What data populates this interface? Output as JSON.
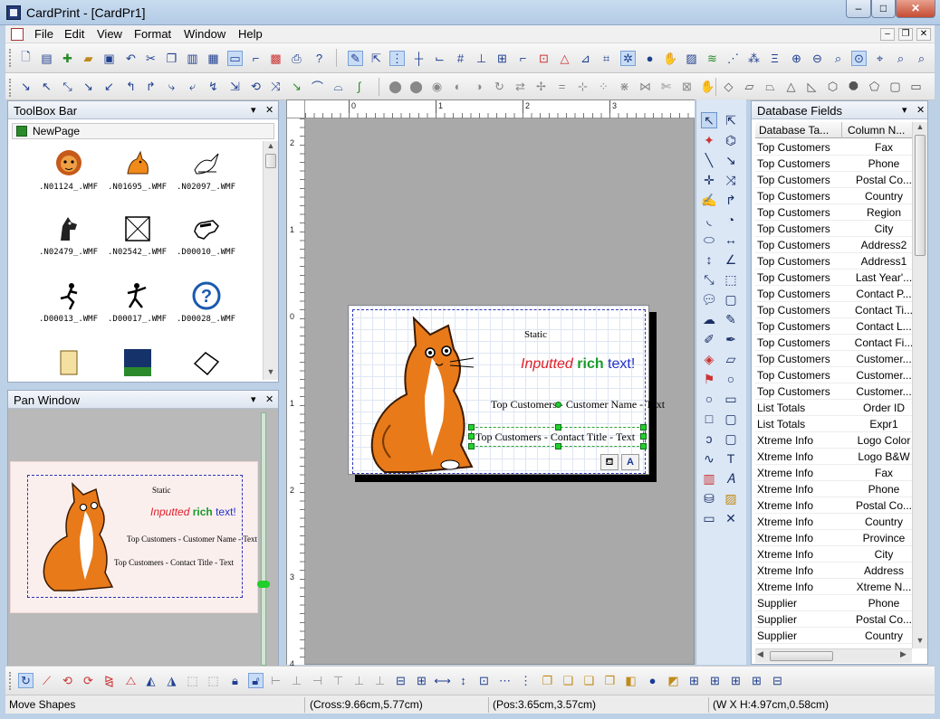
{
  "window": {
    "title": "CardPrint - [CardPr1]",
    "minimize": "–",
    "maximize": "□",
    "close": "✕"
  },
  "menu": {
    "items": [
      "File",
      "Edit",
      "View",
      "Format",
      "Window",
      "Help"
    ],
    "mdi": {
      "minimize": "–",
      "restore": "❐",
      "close": "✕"
    }
  },
  "toolbox": {
    "title": "ToolBox Bar",
    "newpage_label": "NewPage",
    "items": [
      {
        "label": ".N01124_.WMF",
        "icon": "lion-clipart"
      },
      {
        "label": ".N01695_.WMF",
        "icon": "fox-clipart"
      },
      {
        "label": ".N02097_.WMF",
        "icon": "bird-clipart"
      },
      {
        "label": ".N02479_.WMF",
        "icon": "horse-clipart"
      },
      {
        "label": ".N02542_.WMF",
        "icon": "envelope-clipart"
      },
      {
        "label": ".D00010_.WMF",
        "icon": "dog-clipart"
      },
      {
        "label": ".D00013_.WMF",
        "icon": "runner-clipart"
      },
      {
        "label": ".D00017_.WMF",
        "icon": "dancer-clipart"
      },
      {
        "label": ".D00028_.WMF",
        "icon": "help-clipart"
      }
    ]
  },
  "pan": {
    "title": "Pan Window",
    "static_text": "Static",
    "rich_1": "Inputted",
    "rich_2": "rich",
    "rich_3": "text!",
    "line_1": "Top Customers - Customer Name - Text",
    "line_2": "Top Customers - Contact Title - Text"
  },
  "card": {
    "static_text": "Static",
    "rich_1": "Inputted",
    "rich_2": "rich",
    "rich_3": "text!",
    "line_1": "Top Customers - Customer Name - Text",
    "line_2": "Top Customers - Contact Title - Text",
    "colors": {
      "red": "#e0202a",
      "green": "#1a9a2a",
      "blue": "#2230c8"
    }
  },
  "ruler": {
    "h_labels": [
      "0",
      "1",
      "2",
      "3"
    ],
    "v_labels": [
      "2",
      "1",
      "0",
      "1",
      "2",
      "3",
      "4"
    ]
  },
  "database": {
    "title": "Database Fields",
    "col_table": "Database Ta...",
    "col_column": "Column N...",
    "rows": [
      [
        "Top Customers",
        "Fax"
      ],
      [
        "Top Customers",
        "Phone"
      ],
      [
        "Top Customers",
        "Postal Co..."
      ],
      [
        "Top Customers",
        "Country"
      ],
      [
        "Top Customers",
        "Region"
      ],
      [
        "Top Customers",
        "City"
      ],
      [
        "Top Customers",
        "Address2"
      ],
      [
        "Top Customers",
        "Address1"
      ],
      [
        "Top Customers",
        "Last Year'..."
      ],
      [
        "Top Customers",
        "Contact P..."
      ],
      [
        "Top Customers",
        "Contact Ti..."
      ],
      [
        "Top Customers",
        "Contact L..."
      ],
      [
        "Top Customers",
        "Contact Fi..."
      ],
      [
        "Top Customers",
        "Customer..."
      ],
      [
        "Top Customers",
        "Customer..."
      ],
      [
        "Top Customers",
        "Customer..."
      ],
      [
        "List Totals",
        "Order ID"
      ],
      [
        "List Totals",
        "Expr1"
      ],
      [
        "Xtreme Info",
        "Logo Color"
      ],
      [
        "Xtreme Info",
        "Logo B&W"
      ],
      [
        "Xtreme Info",
        "Fax"
      ],
      [
        "Xtreme Info",
        "Phone"
      ],
      [
        "Xtreme Info",
        "Postal Co..."
      ],
      [
        "Xtreme Info",
        "Country"
      ],
      [
        "Xtreme Info",
        "Province"
      ],
      [
        "Xtreme Info",
        "City"
      ],
      [
        "Xtreme Info",
        "Address"
      ],
      [
        "Xtreme Info",
        "Xtreme N..."
      ],
      [
        "Supplier",
        "Phone"
      ],
      [
        "Supplier",
        "Postal Co..."
      ],
      [
        "Supplier",
        "Country"
      ]
    ]
  },
  "status": {
    "mode": "Move Shapes",
    "cross": "(Cross:9.66cm,5.77cm)",
    "pos": "(Pos:3.65cm,3.57cm)",
    "size": "(W X H:4.97cm,0.58cm)"
  }
}
